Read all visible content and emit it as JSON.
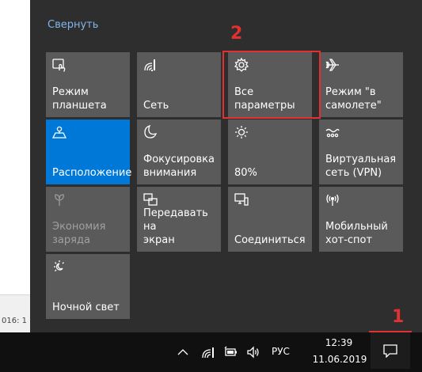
{
  "background_window": {
    "status_text": "016: 1"
  },
  "action_center": {
    "collapse_label": "Свернуть",
    "tiles": [
      {
        "label": "Режим\nпланшета",
        "icon": "tablet-mode-icon",
        "state": "off"
      },
      {
        "label": "Сеть",
        "icon": "network-icon",
        "state": "off"
      },
      {
        "label": "Все параметры",
        "icon": "gear-icon",
        "state": "off"
      },
      {
        "label": "Режим \"в\nсамолете\"",
        "icon": "airplane-icon",
        "state": "off"
      },
      {
        "label": "Расположение",
        "icon": "location-icon",
        "state": "on"
      },
      {
        "label": "Фокусировка\nвнимания",
        "icon": "moon-icon",
        "state": "off"
      },
      {
        "label": "80%",
        "icon": "brightness-icon",
        "state": "off"
      },
      {
        "label": "Виртуальная\nсеть (VPN)",
        "icon": "vpn-icon",
        "state": "off"
      },
      {
        "label": "Экономия\nзаряда",
        "icon": "battery-saver-icon",
        "state": "disabled"
      },
      {
        "label": "Передавать на\nэкран",
        "icon": "project-icon",
        "state": "off"
      },
      {
        "label": "Соединиться",
        "icon": "connect-icon",
        "state": "off"
      },
      {
        "label": "Мобильный\nхот-спот",
        "icon": "hotspot-icon",
        "state": "off"
      },
      {
        "label": "Ночной свет",
        "icon": "night-light-icon",
        "state": "off"
      }
    ]
  },
  "annotations": {
    "marker_1": "1",
    "marker_2": "2",
    "color": "#e33030"
  },
  "taskbar": {
    "language": "РУС",
    "time": "12:39",
    "date": "11.06.2019",
    "icons": [
      "chevron-up-icon",
      "wifi-icon",
      "battery-icon",
      "volume-icon",
      "notification-icon"
    ]
  },
  "colors": {
    "panel_bg": "#2e2e2e",
    "tile_bg": "#5a5a5a",
    "accent": "#0078d7",
    "link": "#7fb6ec",
    "taskbar_bg": "#101010"
  }
}
